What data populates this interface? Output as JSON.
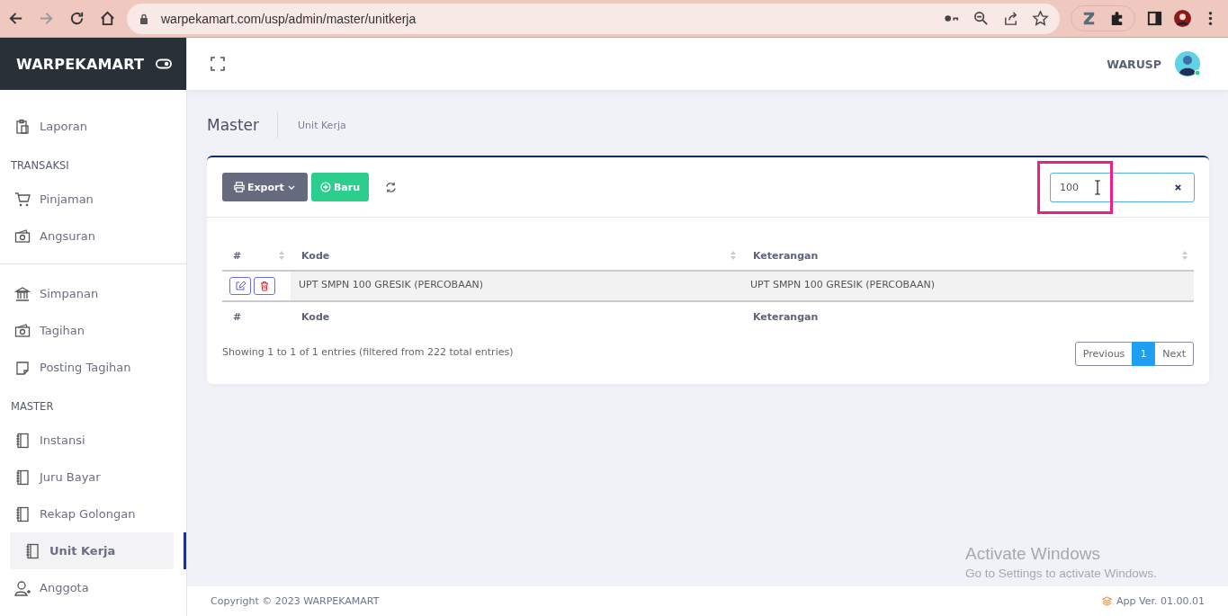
{
  "browser": {
    "url": "warpekamart.com/usp/admin/master/unitkerja"
  },
  "app": {
    "brand": "WARPEKAMART",
    "user_name": "WARUSP"
  },
  "sidebar": {
    "items": [
      {
        "kind": "item",
        "label": "Laporan",
        "selected": false
      },
      {
        "kind": "section",
        "label": "TRANSAKSI"
      },
      {
        "kind": "item",
        "label": "Pinjaman",
        "selected": false
      },
      {
        "kind": "item",
        "label": "Angsuran",
        "selected": false
      },
      {
        "kind": "divider"
      },
      {
        "kind": "item",
        "label": "Simpanan",
        "selected": false
      },
      {
        "kind": "item",
        "label": "Tagihan",
        "selected": false
      },
      {
        "kind": "item",
        "label": "Posting Tagihan",
        "selected": false
      },
      {
        "kind": "section",
        "label": "MASTER"
      },
      {
        "kind": "item",
        "label": "Instansi",
        "selected": false
      },
      {
        "kind": "item",
        "label": "Juru Bayar",
        "selected": false
      },
      {
        "kind": "item",
        "label": "Rekap Golongan",
        "selected": false
      },
      {
        "kind": "item",
        "label": "Unit Kerja",
        "selected": true
      },
      {
        "kind": "item",
        "label": "Anggota",
        "selected": false
      }
    ]
  },
  "breadcrumb": {
    "title": "Master",
    "current": "Unit Kerja"
  },
  "toolbar": {
    "export_label": "Export",
    "new_label": "Baru"
  },
  "search": {
    "value": "100"
  },
  "table": {
    "columns": [
      "#",
      "Kode",
      "Keterangan"
    ],
    "rows": [
      {
        "kode": "UPT SMPN 100 GRESIK (PERCOBAAN)",
        "keterangan": "UPT SMPN 100 GRESIK (PERCOBAAN)"
      }
    ],
    "footer_columns": [
      "#",
      "Kode",
      "Keterangan"
    ],
    "info": "Showing 1 to 1 of 1 entries (filtered from 222 total entries)"
  },
  "pagination": [
    {
      "label": "Previous",
      "selected": false
    },
    {
      "label": "1",
      "selected": true
    },
    {
      "label": "Next",
      "selected": false
    }
  ],
  "footer": {
    "copyright": "Copyright © 2023 WARPEKAMART",
    "version": "App Ver. 01.00.01"
  },
  "os_notice": {
    "title": "Activate Windows",
    "message": "Go to Settings to activate Windows."
  }
}
